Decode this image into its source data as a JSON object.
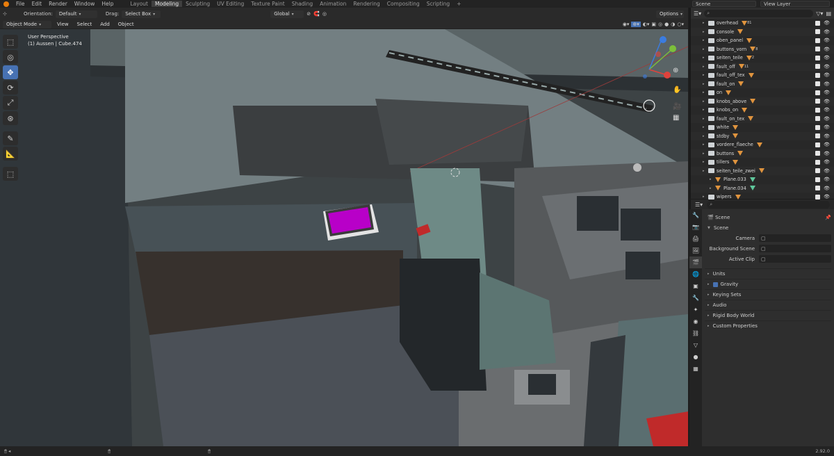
{
  "topbar": {
    "menus": [
      "File",
      "Edit",
      "Render",
      "Window",
      "Help"
    ],
    "workspaces": [
      "Layout",
      "Modeling",
      "Sculpting",
      "UV Editing",
      "Texture Paint",
      "Shading",
      "Animation",
      "Rendering",
      "Compositing",
      "Scripting"
    ],
    "active_workspace": "Modeling",
    "add_tab": "+",
    "scene": "Scene",
    "view_layer": "View Layer"
  },
  "header": {
    "orientation_label": "Orientation:",
    "orientation_value": "Default",
    "drag_label": "Drag:",
    "drag_value": "Select Box",
    "transform_value": "Global",
    "options": "Options"
  },
  "viewport_header": {
    "mode": "Object Mode",
    "menus": [
      "View",
      "Select",
      "Add",
      "Object"
    ]
  },
  "viewport": {
    "perspective": "User Perspective",
    "object_info": "(1) Aussen | Cube.474"
  },
  "tools": [
    "select-box-icon",
    "cursor-icon",
    "move-icon",
    "rotate-icon",
    "scale-icon",
    "transform-icon",
    "annotate-icon",
    "measure-icon",
    "add-cube-icon"
  ],
  "outliner": {
    "rows": [
      {
        "name": "overhead",
        "badge": "81",
        "depth": 0
      },
      {
        "name": "console",
        "badge": "",
        "depth": 0
      },
      {
        "name": "oben_panel",
        "badge": "",
        "depth": 0
      },
      {
        "name": "buttons_vorn",
        "badge": "8",
        "depth": 0
      },
      {
        "name": "seiten_teile",
        "badge": "2",
        "depth": 0
      },
      {
        "name": "fault_off",
        "badge": "11",
        "depth": 0
      },
      {
        "name": "fault_off_tex",
        "badge": "",
        "depth": 0
      },
      {
        "name": "fault_on",
        "badge": "",
        "depth": 0
      },
      {
        "name": "on",
        "badge": "",
        "depth": 0
      },
      {
        "name": "knobs_above",
        "badge": "",
        "depth": 0
      },
      {
        "name": "knobs_on",
        "badge": "",
        "depth": 0
      },
      {
        "name": "fault_on_tex",
        "badge": "",
        "depth": 0
      },
      {
        "name": "white",
        "badge": "",
        "depth": 0
      },
      {
        "name": "stdby",
        "badge": "",
        "depth": 0
      },
      {
        "name": "vordere_flaeche",
        "badge": "",
        "depth": 0
      },
      {
        "name": "buttons",
        "badge": "",
        "depth": 0
      },
      {
        "name": "tillers",
        "badge": "",
        "depth": 0
      },
      {
        "name": "seiten_teile_zwei",
        "badge": "",
        "depth": 0
      },
      {
        "name": "Plane.033",
        "badge": "",
        "depth": 1
      },
      {
        "name": "Plane.034",
        "badge": "",
        "depth": 1
      },
      {
        "name": "wipers",
        "badge": "",
        "depth": 0
      }
    ]
  },
  "properties": {
    "breadcrumb": "Scene",
    "section": "Scene",
    "fields": [
      {
        "label": "Camera",
        "value": ""
      },
      {
        "label": "Background Scene",
        "value": ""
      },
      {
        "label": "Active Clip",
        "value": ""
      }
    ],
    "panels": [
      "Units",
      "Gravity",
      "Keying Sets",
      "Audio",
      "Rigid Body World",
      "Custom Properties"
    ]
  },
  "status": {
    "version": "2.92.0"
  },
  "colors": {
    "accent": "#4772b3",
    "object_orange": "#e0943e",
    "mesh_green": "#5fc79c",
    "tablet_screen": "#b800c8"
  }
}
